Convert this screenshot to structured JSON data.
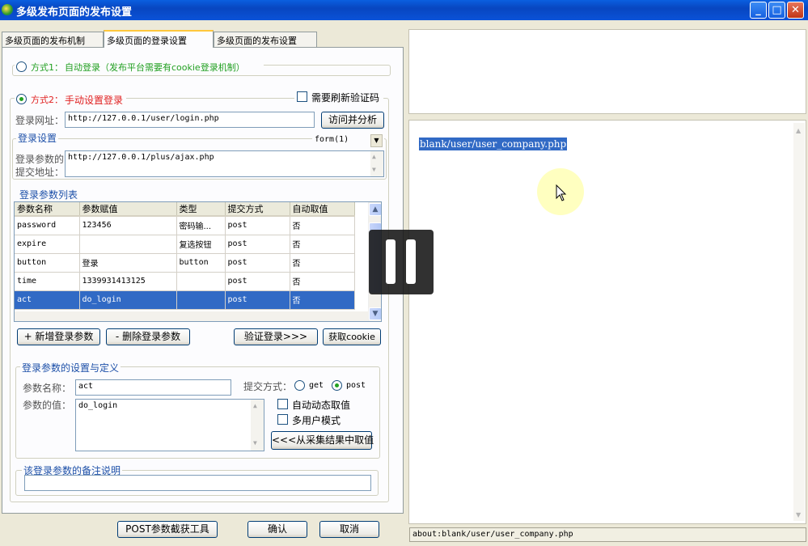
{
  "window": {
    "title": "多级发布页面的发布设置",
    "min": "_",
    "max": "□",
    "close": "✕"
  },
  "tabs": [
    "多级页面的发布机制",
    "多级页面的登录设置",
    "多级页面的发布设置"
  ],
  "mode1": {
    "prefix": "方式1：",
    "label": "自动登录（发布平台需要有cookie登录机制）"
  },
  "mode2": {
    "prefix": "方式2：",
    "label": "手动设置登录",
    "captcha_label": "需要刷新验证码"
  },
  "login": {
    "url_label": "登录网址：",
    "url_value": "http://127.0.0.1/user/login.php",
    "analyze_button": "访问并分析"
  },
  "settings": {
    "group_label": "登录设置",
    "form_select": "form(1)",
    "submit_label_1": "登录参数的",
    "submit_label_2": "提交地址：",
    "submit_value": "http://127.0.0.1/plus/ajax.php"
  },
  "params": {
    "group_label": "登录参数列表",
    "columns": [
      "参数名称",
      "参数赋值",
      "类型",
      "提交方式",
      "自动取值"
    ],
    "rows": [
      [
        "password",
        "123456",
        "密码输...",
        "post",
        "否"
      ],
      [
        "expire",
        "",
        "复选按钮",
        "post",
        "否"
      ],
      [
        "button",
        "登录",
        "button",
        "post",
        "否"
      ],
      [
        "time",
        "1339931413125",
        "",
        "post",
        "否"
      ],
      [
        "act",
        "do_login",
        "",
        "post",
        "否"
      ]
    ]
  },
  "actions": {
    "add": "+ 新增登录参数",
    "remove": "- 删除登录参数",
    "verify": "验证登录>>>",
    "get_cookie": "获取cookie"
  },
  "define": {
    "group_label": "登录参数的设置与定义",
    "name_label": "参数名称：",
    "name_value": "act",
    "value_label": "参数的值：",
    "value_value": "do_login",
    "method_label": "提交方式：",
    "method_get": "get",
    "method_post": "post",
    "auto_value": "自动动态取值",
    "multi_user": "多用户模式",
    "from_result_button": "<<<从采集结果中取值"
  },
  "remark": {
    "group_label": "该登录参数的备注说明",
    "value": ""
  },
  "bottom": {
    "post_tool": "POST参数截获工具",
    "ok": "确认",
    "cancel": "取消"
  },
  "browser": {
    "selected_text": "blank/user/user_company.php",
    "status": "about:blank/user/user_company.php"
  },
  "icons": {
    "pause": "pause-icon",
    "cursor": "mouse-pointer-icon",
    "app": "app-icon"
  }
}
